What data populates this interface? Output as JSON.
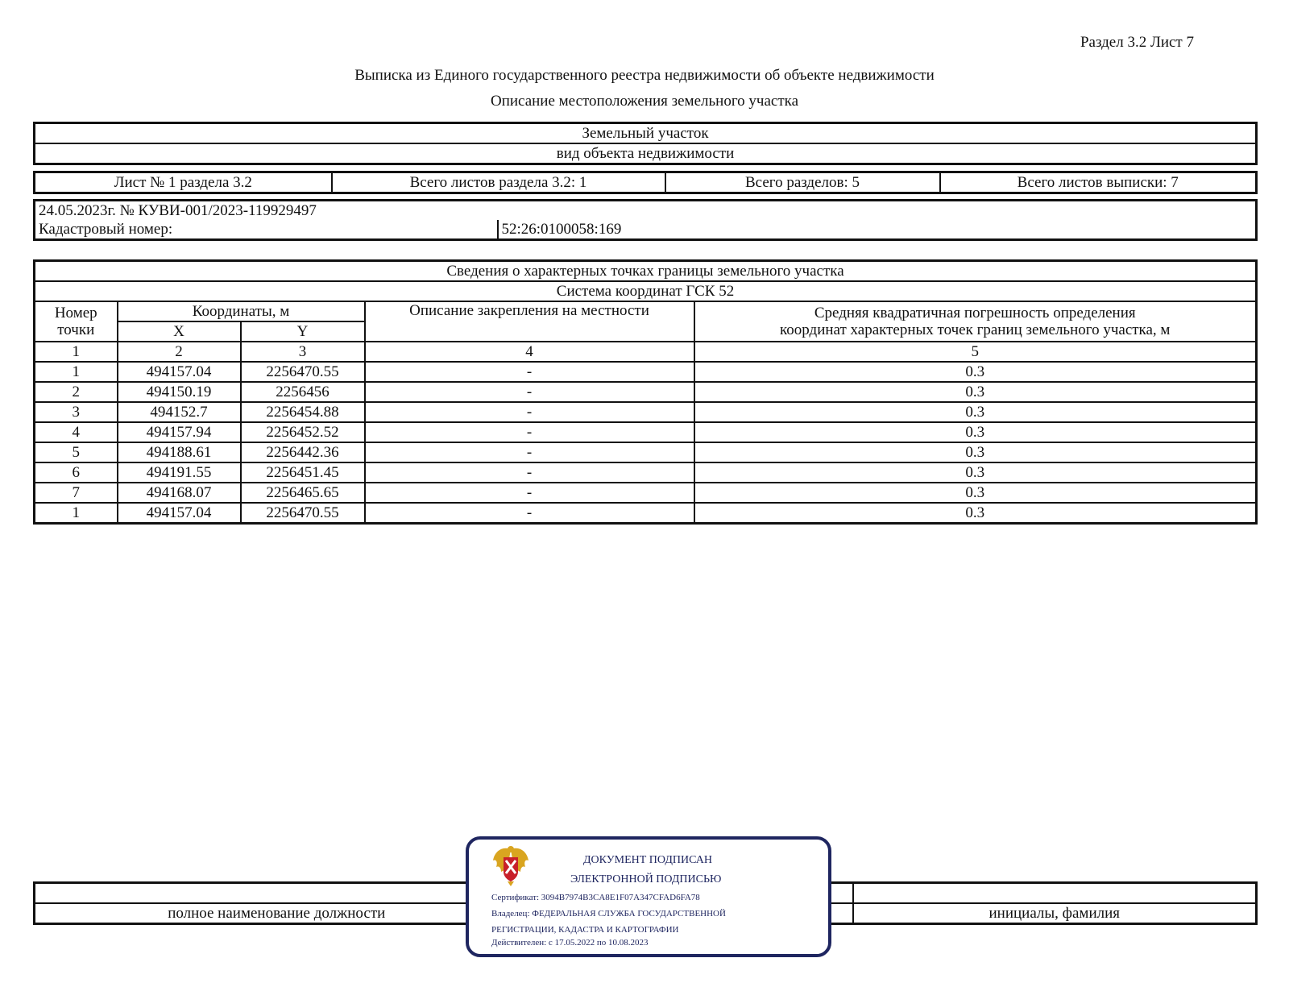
{
  "header": {
    "section_sheet": "Раздел 3.2 Лист 7",
    "title": "Выписка из Единого государственного реестра недвижимости об объекте недвижимости",
    "subtitle": "Описание местоположения земельного участка"
  },
  "object": {
    "type": "Земельный участок",
    "type_caption": "вид объекта недвижимости"
  },
  "sheets": {
    "sheet": "Лист № 1 раздела 3.2",
    "section_sheets": "Всего листов раздела 3.2: 1",
    "sections": "Всего разделов: 5",
    "total_sheets": "Всего листов выписки: 7"
  },
  "doc": {
    "number": "24.05.2023г. № КУВИ-001/2023-119929497",
    "cadastral_label": "Кадастровый номер:",
    "cadastral_value": "52:26:0100058:169"
  },
  "points_table": {
    "title": "Сведения о характерных точках границы земельного участка",
    "system": "Система координат ГСК 52",
    "headers": {
      "point": "Номер точки",
      "coords": "Координаты, м",
      "x": "X",
      "y": "Y",
      "desc": "Описание закрепления на местности",
      "error_line1": "Средняя квадратичная погрешность определения",
      "error_line2": "координат характерных точек границ земельного участка, м"
    },
    "col_numbers": [
      "1",
      "2",
      "3",
      "4",
      "5"
    ],
    "rows": [
      [
        "1",
        "494157.04",
        "2256470.55",
        "-",
        "0.3"
      ],
      [
        "2",
        "494150.19",
        "2256456",
        "-",
        "0.3"
      ],
      [
        "3",
        "494152.7",
        "2256454.88",
        "-",
        "0.3"
      ],
      [
        "4",
        "494157.94",
        "2256452.52",
        "-",
        "0.3"
      ],
      [
        "5",
        "494188.61",
        "2256442.36",
        "-",
        "0.3"
      ],
      [
        "6",
        "494191.55",
        "2256451.45",
        "-",
        "0.3"
      ],
      [
        "7",
        "494168.07",
        "2256465.65",
        "-",
        "0.3"
      ],
      [
        "1",
        "494157.04",
        "2256470.55",
        "-",
        "0.3"
      ]
    ]
  },
  "signature": {
    "position_caption": "полное наименование должности",
    "name_caption": "инициалы, фамилия"
  },
  "stamp": {
    "line1": "ДОКУМЕНТ ПОДПИСАН",
    "line2": "ЭЛЕКТРОННОЙ ПОДПИСЬЮ",
    "certificate": "Сертификат: 3094B7974B3CA8E1F07A347CFAD6FA78",
    "owner1": "Владелец: ФЕДЕРАЛЬНАЯ СЛУЖБА ГОСУДАРСТВЕННОЙ",
    "owner2": "РЕГИСТРАЦИИ, КАДАСТРА И КАРТОГРАФИИ",
    "valid": "Действителен: с 17.05.2022 по 10.08.2023",
    "border_color": "#1f2660",
    "emblem_icon": "russian-coat-of-arms-icon"
  }
}
